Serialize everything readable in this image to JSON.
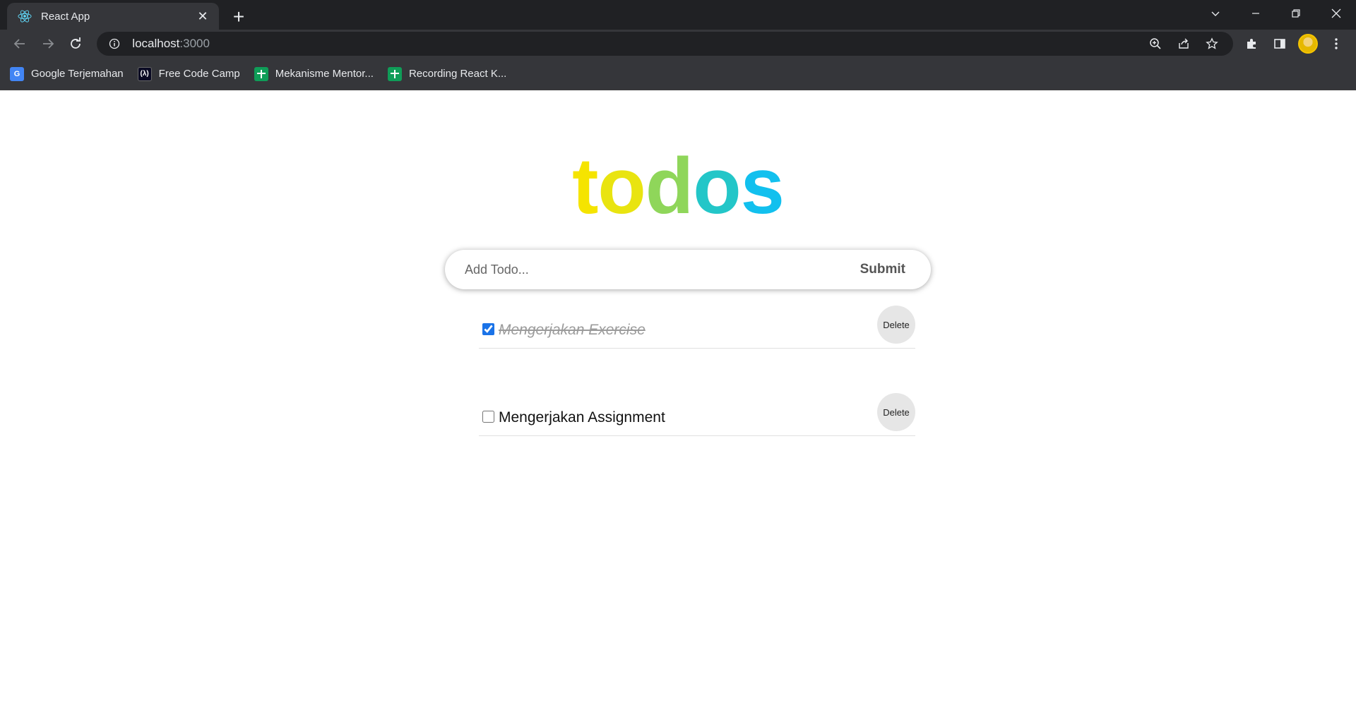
{
  "browser": {
    "tab": {
      "title": "React App",
      "close_glyph": "✕"
    },
    "new_tab_glyph": "+",
    "address": {
      "host": "localhost",
      "port": ":3000"
    },
    "bookmarks": [
      {
        "label": "Google Terjemahan",
        "icon": "google-translate-icon",
        "glyph": "G"
      },
      {
        "label": "Free Code Camp",
        "icon": "freecodecamp-icon",
        "glyph": "(λ)"
      },
      {
        "label": "Mekanisme Mentor...",
        "icon": "sheets-icon",
        "glyph": ""
      },
      {
        "label": "Recording React K...",
        "icon": "sheets-icon",
        "glyph": ""
      }
    ]
  },
  "app": {
    "title_letters": [
      {
        "char": "t",
        "color": "#f5e400"
      },
      {
        "char": "o",
        "color": "#e9e410"
      },
      {
        "char": "d",
        "color": "#8fd65a"
      },
      {
        "char": "o",
        "color": "#23c6c8"
      },
      {
        "char": "s",
        "color": "#12c0ee"
      }
    ],
    "form": {
      "placeholder": "Add Todo...",
      "submit_label": "Submit"
    },
    "todos": [
      {
        "text": "Mengerjakan Exercise",
        "completed": true,
        "delete_label": "Delete"
      },
      {
        "text": "Mengerjakan Assignment",
        "completed": false,
        "delete_label": "Delete"
      }
    ]
  }
}
